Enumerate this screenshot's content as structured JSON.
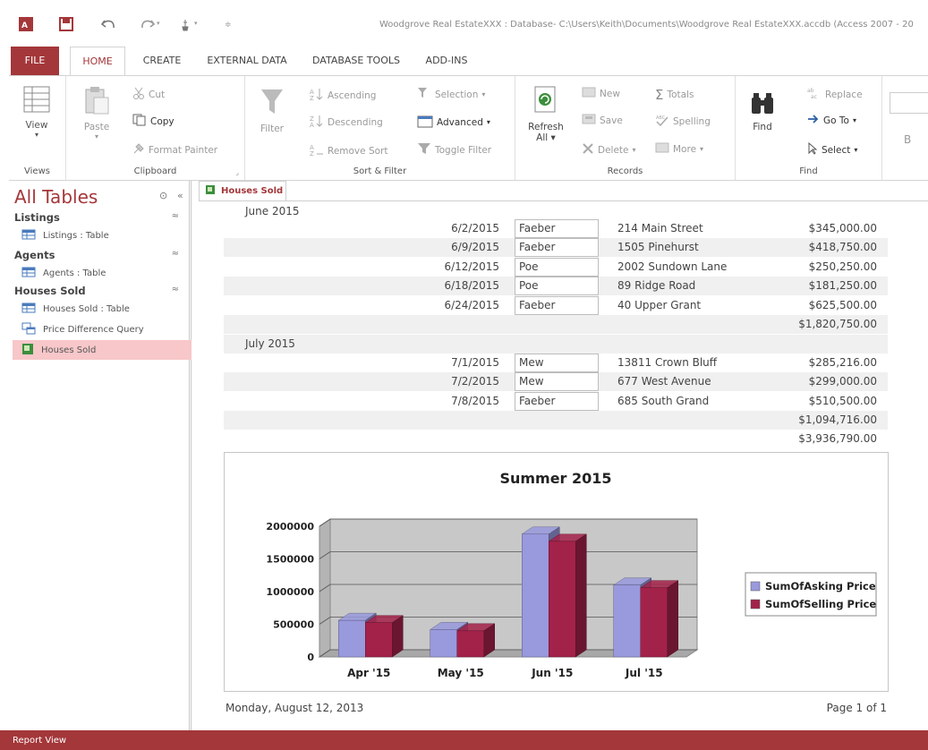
{
  "app": {
    "title": "Woodgrove Real EstateXXX : Database- C:\\Users\\Keith\\Documents\\Woodgrove Real EstateXXX.accdb (Access 2007 - 20"
  },
  "tabs": [
    "FILE",
    "HOME",
    "CREATE",
    "EXTERNAL DATA",
    "DATABASE TOOLS",
    "ADD-INS"
  ],
  "ribbon": {
    "views": {
      "view": "View",
      "group": "Views"
    },
    "clipboard": {
      "paste": "Paste",
      "cut": "Cut",
      "copy": "Copy",
      "format_painter": "Format Painter",
      "group": "Clipboard"
    },
    "sort_filter": {
      "filter": "Filter",
      "ascending": "Ascending",
      "descending": "Descending",
      "remove_sort": "Remove Sort",
      "selection": "Selection",
      "advanced": "Advanced",
      "toggle_filter": "Toggle Filter",
      "group": "Sort & Filter"
    },
    "records": {
      "refresh": "Refresh",
      "refresh_all": "All",
      "new": "New",
      "save": "Save",
      "delete": "Delete",
      "totals": "Totals",
      "spelling": "Spelling",
      "more": "More",
      "group": "Records"
    },
    "find": {
      "find": "Find",
      "replace": "Replace",
      "goto": "Go To",
      "select": "Select",
      "group": "Find"
    },
    "bold": "B"
  },
  "nav": {
    "title": "All Tables",
    "groups": [
      {
        "name": "Listings",
        "items": [
          {
            "label": "Listings : Table",
            "icon": "table-icon"
          }
        ]
      },
      {
        "name": "Agents",
        "items": [
          {
            "label": "Agents : Table",
            "icon": "table-icon"
          }
        ]
      },
      {
        "name": "Houses Sold",
        "items": [
          {
            "label": "Houses Sold : Table",
            "icon": "table-icon"
          },
          {
            "label": "Price Difference Query",
            "icon": "query-icon"
          },
          {
            "label": "Houses Sold",
            "icon": "report-icon"
          }
        ]
      }
    ]
  },
  "doc_tab": "Houses Sold",
  "report": {
    "groups": [
      {
        "month": "June 2015",
        "rows": [
          {
            "date": "6/2/2015",
            "agent": "Faeber",
            "address": "214 Main Street",
            "price": "$345,000.00"
          },
          {
            "date": "6/9/2015",
            "agent": "Faeber",
            "address": "1505 Pinehurst",
            "price": "$418,750.00"
          },
          {
            "date": "6/12/2015",
            "agent": "Poe",
            "address": "2002 Sundown Lane",
            "price": "$250,250.00"
          },
          {
            "date": "6/18/2015",
            "agent": "Poe",
            "address": "89 Ridge Road",
            "price": "$181,250.00"
          },
          {
            "date": "6/24/2015",
            "agent": "Faeber",
            "address": "40 Upper Grant",
            "price": "$625,500.00"
          }
        ],
        "subtotal": "$1,820,750.00"
      },
      {
        "month": "July 2015",
        "rows": [
          {
            "date": "7/1/2015",
            "agent": "Mew",
            "address": "13811 Crown Bluff",
            "price": "$285,216.00"
          },
          {
            "date": "7/2/2015",
            "agent": "Mew",
            "address": "677 West Avenue",
            "price": "$299,000.00"
          },
          {
            "date": "7/8/2015",
            "agent": "Faeber",
            "address": "685 South Grand",
            "price": "$510,500.00"
          }
        ],
        "subtotal": "$1,094,716.00"
      }
    ],
    "grand_total": "$3,936,790.00",
    "footer_date": "Monday, August 12, 2013",
    "footer_page": "Page 1 of 1"
  },
  "chart_data": {
    "type": "bar",
    "title": "Summer 2015",
    "categories": [
      "Apr '15",
      "May '15",
      "Jun '15",
      "Jul '15"
    ],
    "series": [
      {
        "name": "SumOfAsking Price",
        "values": [
          560000,
          420000,
          1880000,
          1100000
        ],
        "color": "#9999dd"
      },
      {
        "name": "SumOfSelling Price",
        "values": [
          525000,
          400000,
          1770000,
          1060000
        ],
        "color": "#a3224a"
      }
    ],
    "ylim": [
      0,
      2000000
    ],
    "yticks": [
      "0",
      "500000",
      "1000000",
      "1500000",
      "2000000"
    ],
    "legend": "right",
    "grid": true
  },
  "status": "Report View",
  "colors": {
    "accent": "#a4373a"
  }
}
